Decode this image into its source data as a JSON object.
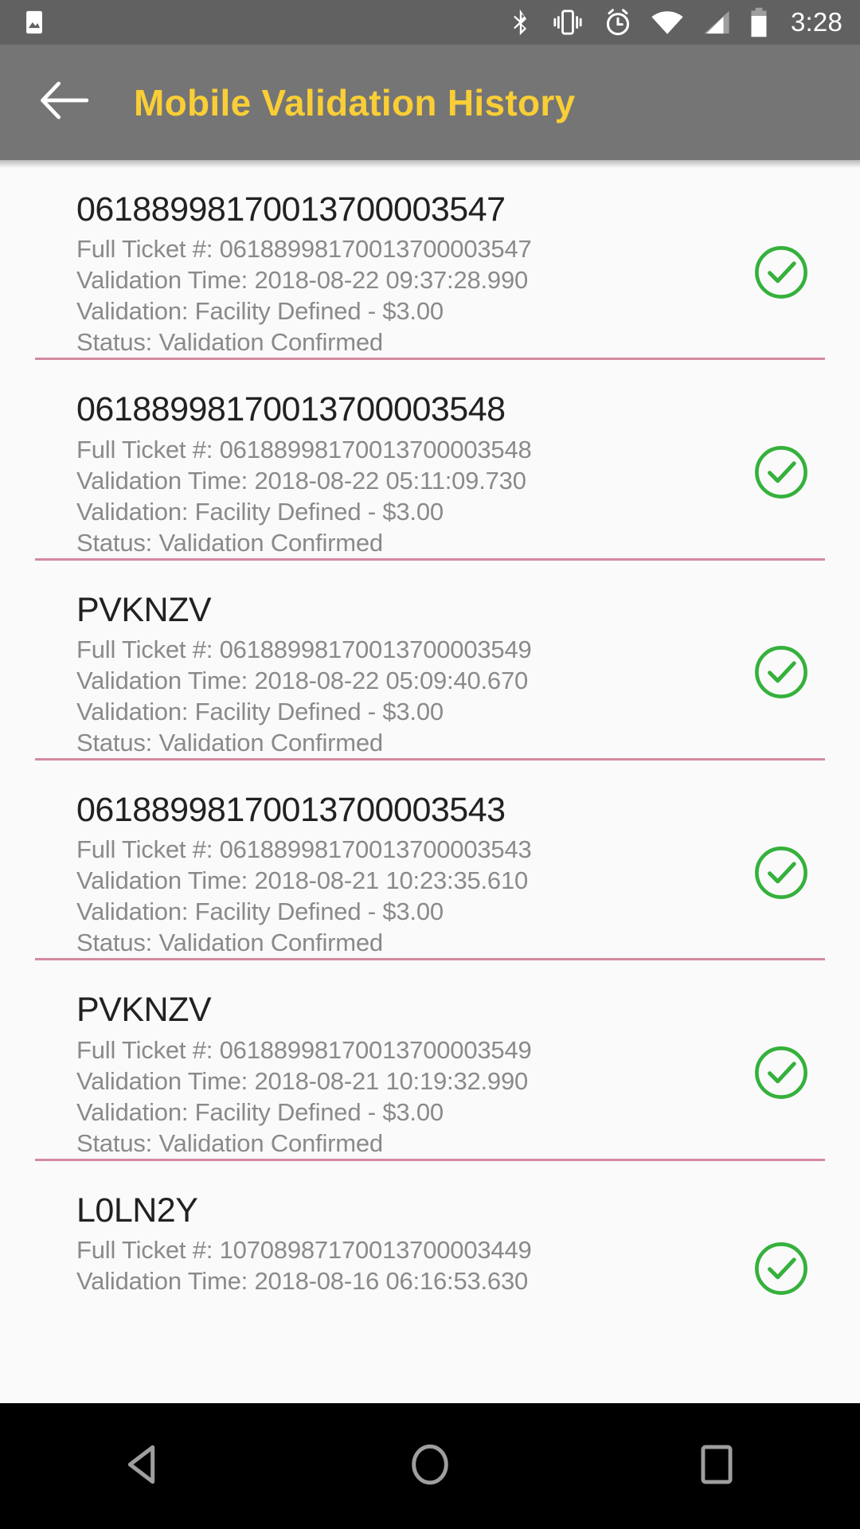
{
  "statusbar": {
    "clock": "3:28",
    "icons": {
      "photo": "image-icon",
      "bluetooth": "bluetooth-icon",
      "vibrate": "vibrate-icon",
      "alarm": "alarm-icon",
      "wifi": "wifi-icon",
      "signal": "cellular-signal-icon",
      "battery": "battery-icon"
    },
    "background_color": "#616161"
  },
  "appbar": {
    "title": "Mobile Validation History",
    "back_icon": "arrow-left-icon",
    "title_color": "#F9CE36",
    "background_color": "#757575"
  },
  "list": {
    "divider_color": "#d4899f",
    "check_color": "#35b13c",
    "labels": {
      "full_ticket": "Full Ticket #:",
      "validation_time": "Validation Time:",
      "validation": "Validation:",
      "status": "Status:"
    },
    "items": [
      {
        "title": "06188998170013700003547",
        "full_ticket": "Full Ticket #:  06188998170013700003547",
        "validation_time": "Validation Time: 2018-08-22 09:37:28.990",
        "validation": "Validation: Facility Defined - $3.00",
        "status": "Status: Validation Confirmed",
        "status_icon": "check-circle-icon"
      },
      {
        "title": "06188998170013700003548",
        "full_ticket": "Full Ticket #:  06188998170013700003548",
        "validation_time": "Validation Time: 2018-08-22 05:11:09.730",
        "validation": "Validation: Facility Defined - $3.00",
        "status": "Status: Validation Confirmed",
        "status_icon": "check-circle-icon"
      },
      {
        "title": "PVKNZV",
        "full_ticket": "Full Ticket #:  06188998170013700003549",
        "validation_time": "Validation Time: 2018-08-22 05:09:40.670",
        "validation": "Validation: Facility Defined - $3.00",
        "status": "Status: Validation Confirmed",
        "status_icon": "check-circle-icon"
      },
      {
        "title": "06188998170013700003543",
        "full_ticket": "Full Ticket #:  06188998170013700003543",
        "validation_time": "Validation Time: 2018-08-21 10:23:35.610",
        "validation": "Validation: Facility Defined - $3.00",
        "status": "Status: Validation Confirmed",
        "status_icon": "check-circle-icon"
      },
      {
        "title": "PVKNZV",
        "full_ticket": "Full Ticket #:  06188998170013700003549",
        "validation_time": "Validation Time: 2018-08-21 10:19:32.990",
        "validation": "Validation: Facility Defined - $3.00",
        "status": "Status: Validation Confirmed",
        "status_icon": "check-circle-icon"
      },
      {
        "title": "L0LN2Y",
        "full_ticket": "Full Ticket #:  10708987170013700003449",
        "validation_time": "Validation Time: 2018-08-16 06:16:53.630",
        "validation": "",
        "status": "",
        "status_icon": "check-circle-icon"
      }
    ]
  },
  "navbar": {
    "back": "nav-back-icon",
    "home": "nav-home-icon",
    "recents": "nav-recents-icon",
    "background_color": "#000000"
  }
}
